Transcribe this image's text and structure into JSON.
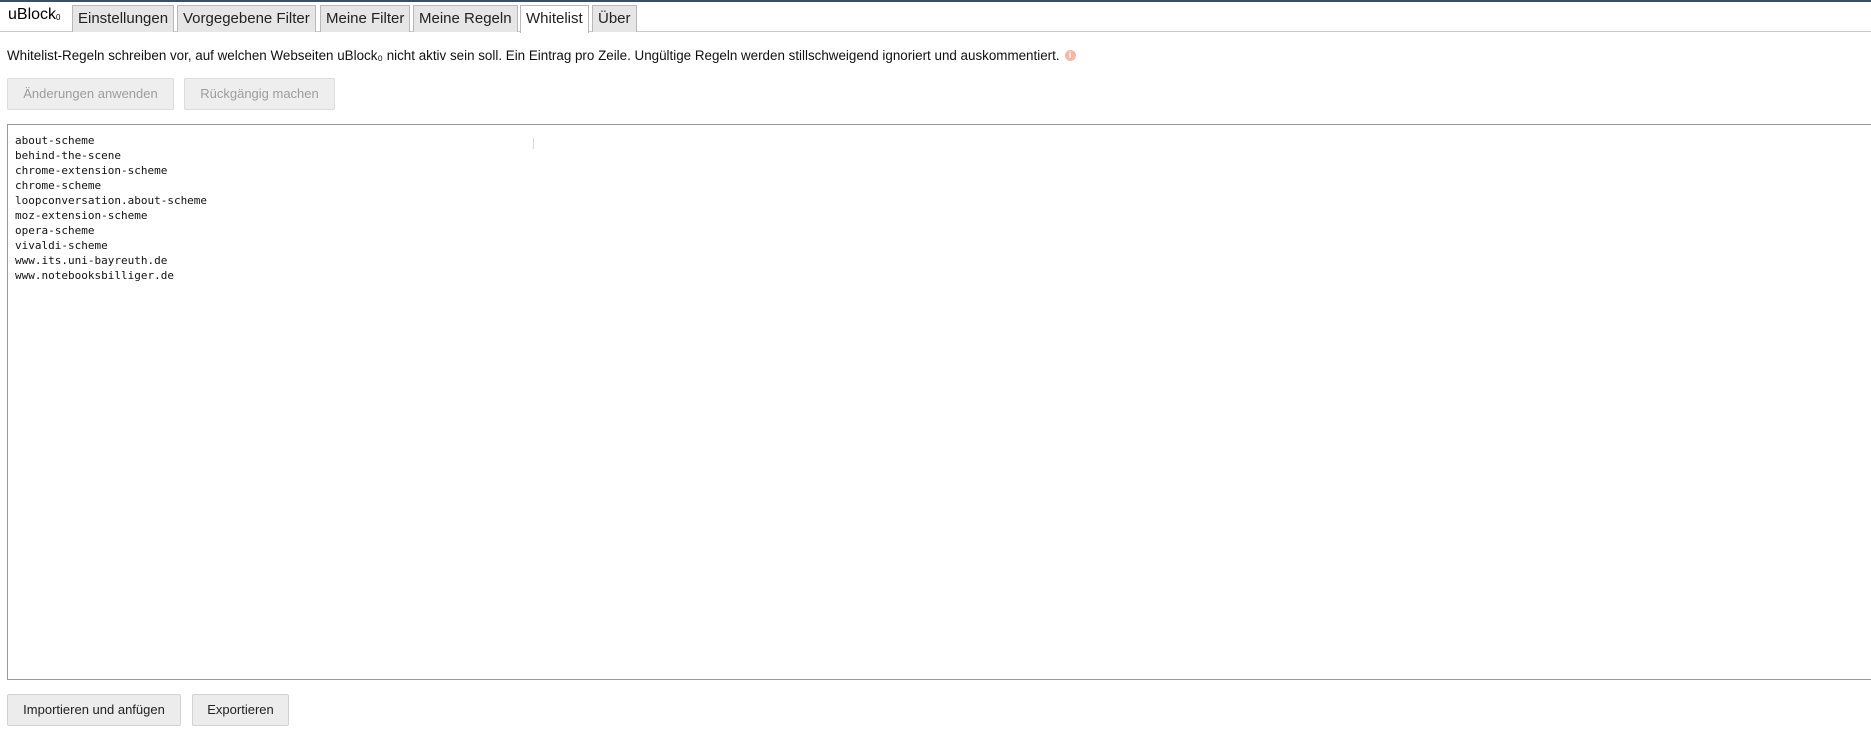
{
  "header": {
    "brand": "uBlock",
    "brand_suffix": "0",
    "tabs": [
      {
        "label": "Einstellungen"
      },
      {
        "label": "Vorgegebene Filter"
      },
      {
        "label": "Meine Filter"
      },
      {
        "label": "Meine Regeln"
      },
      {
        "label": "Whitelist",
        "active": true
      },
      {
        "label": "Über"
      }
    ]
  },
  "main": {
    "description": "Whitelist-Regeln schreiben vor, auf welchen Webseiten uBlock₀ nicht aktiv sein soll. Ein Eintrag pro Zeile. Ungültige Regeln werden stillschweigend ignoriert und auskommentiert.",
    "info_icon": "info-icon",
    "apply_label": "Änderungen anwenden",
    "revert_label": "Rückgängig machen",
    "entries": [
      "about-scheme",
      "behind-the-scene",
      "chrome-extension-scheme",
      "chrome-scheme",
      "loopconversation.about-scheme",
      "moz-extension-scheme",
      "opera-scheme",
      "vivaldi-scheme",
      "www.its.uni-bayreuth.de",
      "www.notebooksbilliger.de"
    ],
    "import_label": "Importieren und anfügen",
    "export_label": "Exportieren"
  },
  "colors": {
    "top_bar": "#3a4f63",
    "info_icon": "#f6b7a8"
  }
}
